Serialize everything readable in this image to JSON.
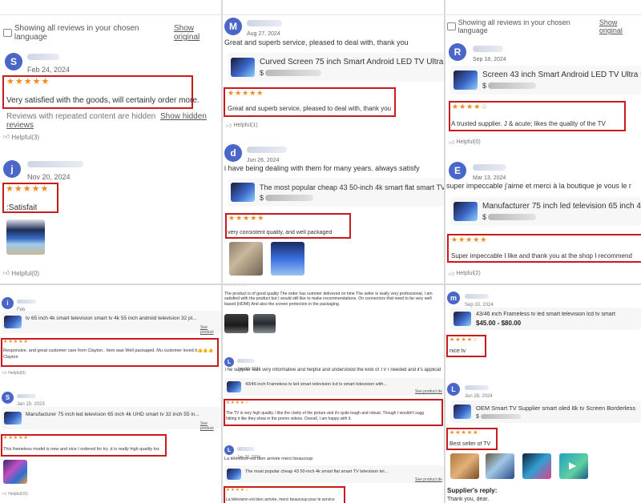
{
  "lang_note": {
    "text": "Showing all reviews in your chosen language",
    "link": "Show original"
  },
  "panel_top_left": {
    "review1": {
      "initial": "S",
      "avatar_color": "#4a66c8",
      "date": "Feb 24, 2024",
      "stars": "★★★★★",
      "text": "Very satisfied with the goods, will certainly order more."
    },
    "hidden_note": {
      "text": "Reviews with repeated content are hidden",
      "link": "Show hidden reviews"
    },
    "helpful1": "Helpful(3)",
    "review2": {
      "initial": "j",
      "avatar_color": "#4a66c8",
      "date": "Nov 20, 2024",
      "stars": "★★★★★",
      "text": ":Satisfait"
    },
    "helpful2": "Helpful(0)"
  },
  "panel_top_middle": {
    "review1": {
      "initial": "M",
      "avatar_color": "#4a66c8",
      "date": "Aug 27, 2024",
      "body": "Great and superb service, pleased to deal with, thank you",
      "product": "Curved Screen 75 inch Smart Android LED TV Ultra HD 4K",
      "price_prefix": "$",
      "stars": "★★★★★",
      "text": "Great and superb service, pleased to deal with, thank you"
    },
    "helpful1": "Helpful(1)",
    "review2": {
      "initial": "d",
      "avatar_color": "#4a66c8",
      "date": "Jun 26, 2024",
      "body": "i have being dealing with them for many years. always satisfy",
      "product": "The most popular cheap 43 50-inch 4k smart flat smart TV",
      "price_prefix": "$",
      "stars": "★★★★★",
      "text": "very consistent quality, and well packaged"
    }
  },
  "panel_top_right": {
    "review1": {
      "initial": "R",
      "avatar_color": "#4a66c8",
      "date": "Sep 18, 2024",
      "product": "Screen 43 inch Smart Android LED TV Ultra HD 4",
      "price_prefix": "$",
      "stars": "★★★★☆",
      "text": "A trusted supplier. J & acute; likes the quality of the TV"
    },
    "helpful1": "Helpful(0)",
    "review2": {
      "initial": "E",
      "avatar_color": "#4a66c8",
      "date": "Mar 13, 2024",
      "body": "super impeccable j'aime et merci à la boutique je vous le r",
      "product": "Manufacturer 75 inch led television 65 inch 4k",
      "price_prefix": "$",
      "stars": "★★★★★",
      "text": "Super impeccable I like and thank you at the shop I recommend"
    },
    "helpful2": "Helpful(2)"
  },
  "panel_bottom_left": {
    "review1": {
      "initial": "i",
      "avatar_color": "#4a66c8",
      "date": "Feb",
      "product": "tv 65 inch 4k smart television smart tv 4k 55 inch android television 32 pl...",
      "see": "See product",
      "stars": "★★★★★",
      "text": "Responsive, and great customer care from Clayton.. Item was Well packaged. Mu customer loved it👍👍👍",
      "text2": "Clayton"
    },
    "helpful1": "Helpful(0)",
    "review2": {
      "initial": "S",
      "avatar_color": "#4a66c8",
      "date": "Jan 19, 2023",
      "product": "Manufacturer 75 inch led television 65 inch 4k UHD smart tv 32 inch 55 in...",
      "see": "See product",
      "stars": "★★★★★",
      "text": "This frameless model is new and nice I ordered for try ,it is really high quality tvs"
    },
    "helpful2": "Helpful(10)"
  },
  "panel_bottom_middle": {
    "top_text": "The product is of good quality The order has summer delivered on time The seller is really very professional, I am satisfied with the product but I would still like to make recommendations. On connectors that need to be very well based (HDMI) And also the screen protection in the packaging.",
    "review1": {
      "initial": "L",
      "avatar_color": "#4a66c8",
      "date": "Jan 30, 2024",
      "body": "The supplier was very informative and helpful and understood the kind of TV I needed and it's applicat",
      "product": "43/46 inch Frameless tv led smart television lcd tv smart television with...",
      "see": "See product de",
      "stars": "★★★★☆",
      "text": "The TV is very high quality. I like the clarity of the picture and it's quite tough and robust. Though I wouldn't sugg",
      "text2": "hitting it like they show in the promo videos. Overall, I am happy with it."
    },
    "review2": {
      "initial": "L",
      "avatar_color": "#4a66c8",
      "date": "Jan 30, 2024",
      "body": "La télévision est bien arrivée merci beaucoup",
      "product": "The most popular cheap 43 50-inch 4k smart flat smart TV television tel...",
      "see": "See product de",
      "stars": "★★★★☆",
      "text": "La télévision est bien arrivée, merci beaucoup pour le service"
    }
  },
  "panel_bottom_right": {
    "review1": {
      "initial": "m",
      "avatar_color": "#4a66c8",
      "date": "Sep 10, 2024",
      "product": "43/46 inch Frameless tv led smart television lcd tv smart",
      "price": "$45.00 - $80.00",
      "stars": "★★★★☆",
      "text": "nice tv"
    },
    "review2": {
      "initial": "L",
      "avatar_color": "#4a66c8",
      "date": "Jun 28, 2024",
      "product": "OEM Smart TV Supplier smart oled 8k tv Screen Borderless",
      "price_prefix": "$",
      "stars": "★★★★★",
      "text": "Best seller of TV"
    },
    "supplier_reply": "Supplier's reply:",
    "reply_text": "Thank you, dear."
  }
}
